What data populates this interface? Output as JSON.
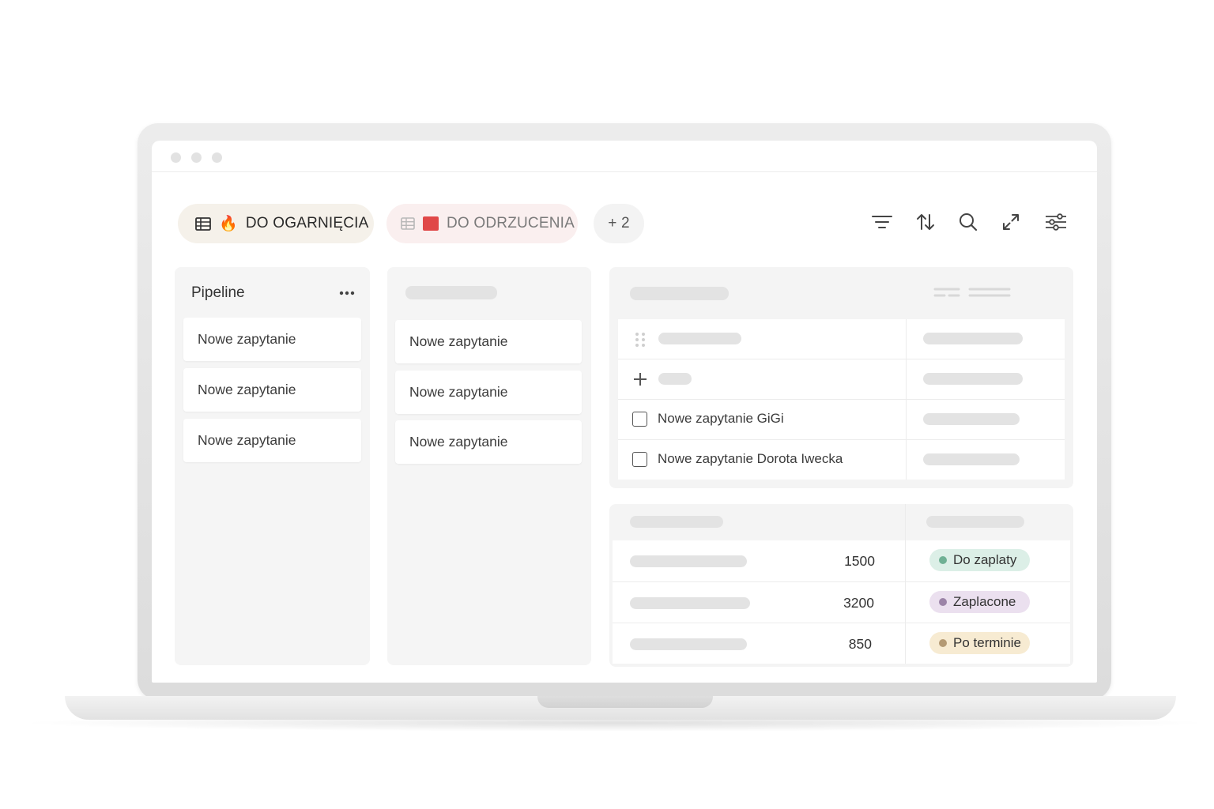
{
  "tabs": [
    {
      "label": "DO OGARNIĘCIA",
      "icon": "table-icon",
      "emoji": "🔥"
    },
    {
      "label": "DO ODRZUCENIA",
      "icon": "table-icon",
      "flag_color": "#e04848"
    },
    {
      "label": "+ 2"
    }
  ],
  "toolbar": [
    "filter-icon",
    "sort-icon",
    "search-icon",
    "expand-icon",
    "settings-sliders-icon"
  ],
  "columns": [
    {
      "title": "Pipeline",
      "cards": [
        "Nowe zapytanie",
        "Nowe zapytanie",
        "Nowe zapytanie"
      ]
    },
    {
      "title": "",
      "cards": [
        "Nowe zapytanie",
        "Nowe zapytanie",
        "Nowe zapytanie"
      ]
    }
  ],
  "task_table": {
    "rows": [
      {
        "type": "drag"
      },
      {
        "type": "add"
      },
      {
        "type": "checkbox",
        "label": "Nowe zapytanie GiGi",
        "checked": false
      },
      {
        "type": "checkbox",
        "label": "Nowe zapytanie Dorota Iwecka",
        "checked": false
      }
    ]
  },
  "invoice_table": {
    "rows": [
      {
        "amount": "1500",
        "status": "Do zaplaty",
        "status_bg": "#dcefe7",
        "status_dot": "#6fb094"
      },
      {
        "amount": "3200",
        "status": "Zaplacone",
        "status_bg": "#ebe0ef",
        "status_dot": "#9c84a8"
      },
      {
        "amount": "850",
        "status": "Po terminie",
        "status_bg": "#f7ebd2",
        "status_dot": "#b49a74"
      }
    ]
  }
}
